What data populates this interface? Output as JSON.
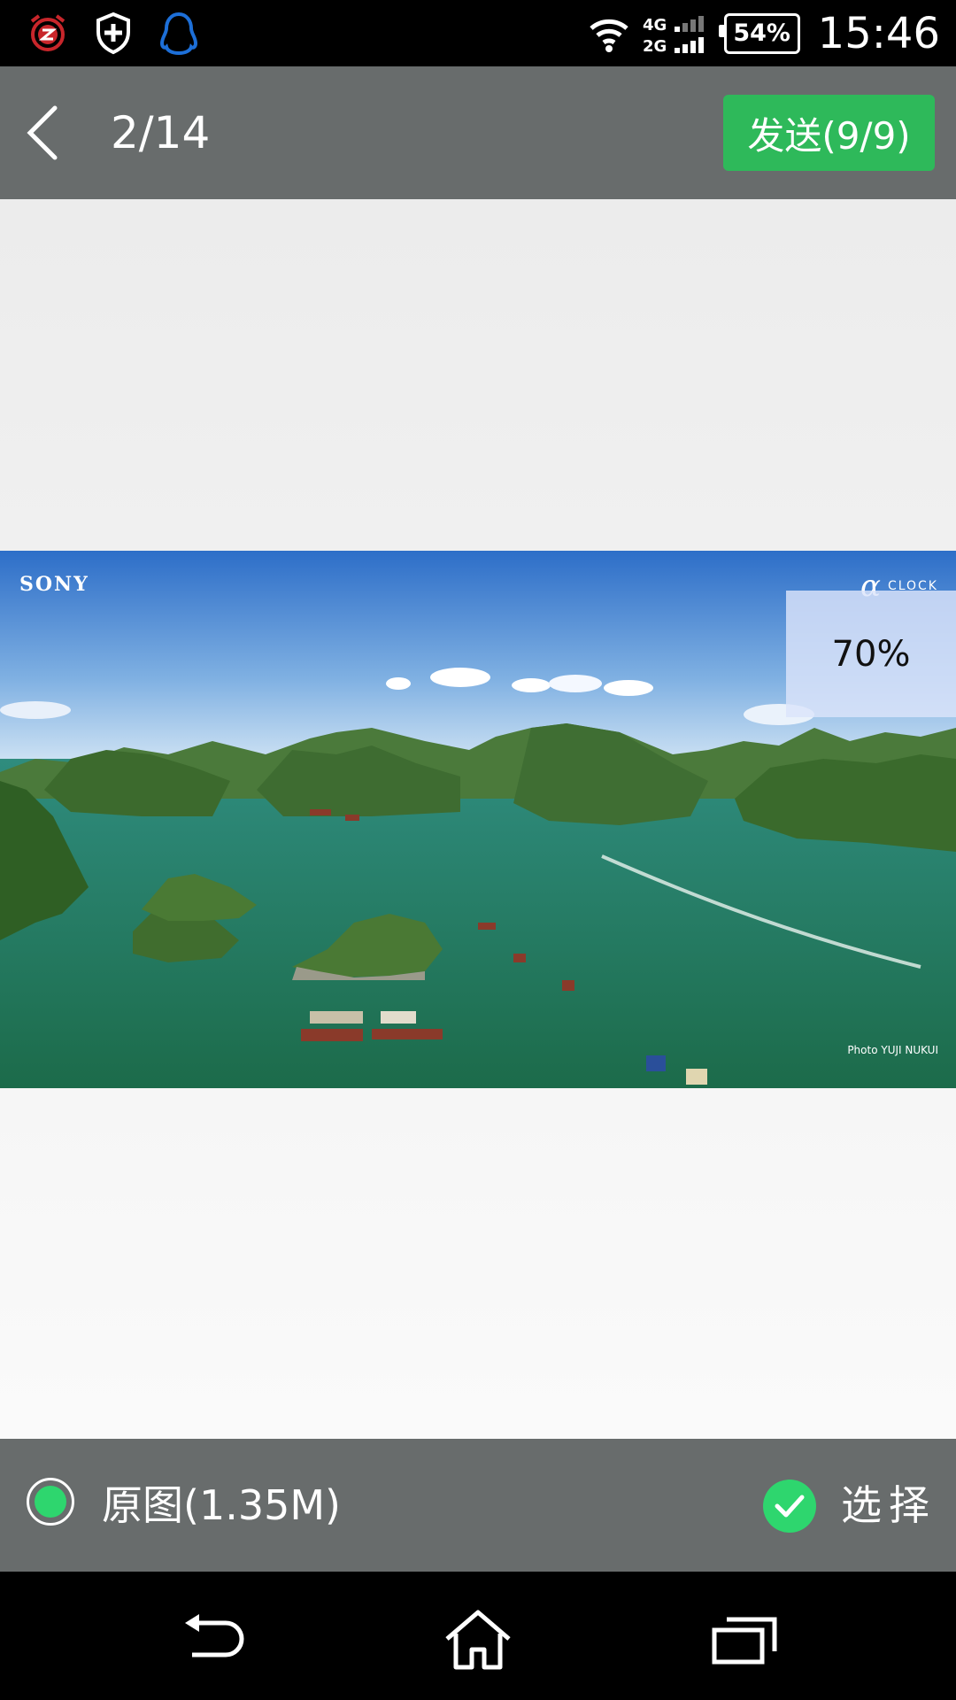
{
  "status_bar": {
    "left_icons": [
      "alarm-clock-icon",
      "shield-plus-icon",
      "qq-penguin-icon"
    ],
    "network": "4G/2G",
    "battery_percent": "54%",
    "time": "15:46"
  },
  "app_bar": {
    "counter": "2/14",
    "send_label": "发送(9/9)"
  },
  "preview": {
    "watermark_brand": "SONY",
    "watermark_alpha": "α",
    "watermark_clock": "CLOCK",
    "photo_credit": "Photo YUJI NUKUI",
    "progress": "70%"
  },
  "bottom_bar": {
    "original_label": "原图(1.35M)",
    "select_label": "选择"
  },
  "nav_bar": {
    "buttons": [
      "back",
      "home",
      "recents"
    ]
  },
  "colors": {
    "bar_gray": "#686c6c",
    "accent_green": "#2eb95a",
    "check_green": "#2ed66e"
  }
}
